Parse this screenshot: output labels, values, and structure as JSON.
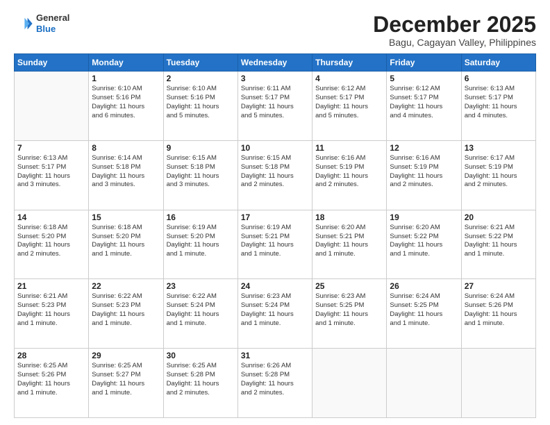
{
  "logo": {
    "general": "General",
    "blue": "Blue"
  },
  "header": {
    "month": "December 2025",
    "location": "Bagu, Cagayan Valley, Philippines"
  },
  "weekdays": [
    "Sunday",
    "Monday",
    "Tuesday",
    "Wednesday",
    "Thursday",
    "Friday",
    "Saturday"
  ],
  "weeks": [
    [
      {
        "day": "",
        "detail": ""
      },
      {
        "day": "1",
        "detail": "Sunrise: 6:10 AM\nSunset: 5:16 PM\nDaylight: 11 hours\nand 6 minutes."
      },
      {
        "day": "2",
        "detail": "Sunrise: 6:10 AM\nSunset: 5:16 PM\nDaylight: 11 hours\nand 5 minutes."
      },
      {
        "day": "3",
        "detail": "Sunrise: 6:11 AM\nSunset: 5:17 PM\nDaylight: 11 hours\nand 5 minutes."
      },
      {
        "day": "4",
        "detail": "Sunrise: 6:12 AM\nSunset: 5:17 PM\nDaylight: 11 hours\nand 5 minutes."
      },
      {
        "day": "5",
        "detail": "Sunrise: 6:12 AM\nSunset: 5:17 PM\nDaylight: 11 hours\nand 4 minutes."
      },
      {
        "day": "6",
        "detail": "Sunrise: 6:13 AM\nSunset: 5:17 PM\nDaylight: 11 hours\nand 4 minutes."
      }
    ],
    [
      {
        "day": "7",
        "detail": "Sunrise: 6:13 AM\nSunset: 5:17 PM\nDaylight: 11 hours\nand 3 minutes."
      },
      {
        "day": "8",
        "detail": "Sunrise: 6:14 AM\nSunset: 5:18 PM\nDaylight: 11 hours\nand 3 minutes."
      },
      {
        "day": "9",
        "detail": "Sunrise: 6:15 AM\nSunset: 5:18 PM\nDaylight: 11 hours\nand 3 minutes."
      },
      {
        "day": "10",
        "detail": "Sunrise: 6:15 AM\nSunset: 5:18 PM\nDaylight: 11 hours\nand 2 minutes."
      },
      {
        "day": "11",
        "detail": "Sunrise: 6:16 AM\nSunset: 5:19 PM\nDaylight: 11 hours\nand 2 minutes."
      },
      {
        "day": "12",
        "detail": "Sunrise: 6:16 AM\nSunset: 5:19 PM\nDaylight: 11 hours\nand 2 minutes."
      },
      {
        "day": "13",
        "detail": "Sunrise: 6:17 AM\nSunset: 5:19 PM\nDaylight: 11 hours\nand 2 minutes."
      }
    ],
    [
      {
        "day": "14",
        "detail": "Sunrise: 6:18 AM\nSunset: 5:20 PM\nDaylight: 11 hours\nand 2 minutes."
      },
      {
        "day": "15",
        "detail": "Sunrise: 6:18 AM\nSunset: 5:20 PM\nDaylight: 11 hours\nand 1 minute."
      },
      {
        "day": "16",
        "detail": "Sunrise: 6:19 AM\nSunset: 5:20 PM\nDaylight: 11 hours\nand 1 minute."
      },
      {
        "day": "17",
        "detail": "Sunrise: 6:19 AM\nSunset: 5:21 PM\nDaylight: 11 hours\nand 1 minute."
      },
      {
        "day": "18",
        "detail": "Sunrise: 6:20 AM\nSunset: 5:21 PM\nDaylight: 11 hours\nand 1 minute."
      },
      {
        "day": "19",
        "detail": "Sunrise: 6:20 AM\nSunset: 5:22 PM\nDaylight: 11 hours\nand 1 minute."
      },
      {
        "day": "20",
        "detail": "Sunrise: 6:21 AM\nSunset: 5:22 PM\nDaylight: 11 hours\nand 1 minute."
      }
    ],
    [
      {
        "day": "21",
        "detail": "Sunrise: 6:21 AM\nSunset: 5:23 PM\nDaylight: 11 hours\nand 1 minute."
      },
      {
        "day": "22",
        "detail": "Sunrise: 6:22 AM\nSunset: 5:23 PM\nDaylight: 11 hours\nand 1 minute."
      },
      {
        "day": "23",
        "detail": "Sunrise: 6:22 AM\nSunset: 5:24 PM\nDaylight: 11 hours\nand 1 minute."
      },
      {
        "day": "24",
        "detail": "Sunrise: 6:23 AM\nSunset: 5:24 PM\nDaylight: 11 hours\nand 1 minute."
      },
      {
        "day": "25",
        "detail": "Sunrise: 6:23 AM\nSunset: 5:25 PM\nDaylight: 11 hours\nand 1 minute."
      },
      {
        "day": "26",
        "detail": "Sunrise: 6:24 AM\nSunset: 5:25 PM\nDaylight: 11 hours\nand 1 minute."
      },
      {
        "day": "27",
        "detail": "Sunrise: 6:24 AM\nSunset: 5:26 PM\nDaylight: 11 hours\nand 1 minute."
      }
    ],
    [
      {
        "day": "28",
        "detail": "Sunrise: 6:25 AM\nSunset: 5:26 PM\nDaylight: 11 hours\nand 1 minute."
      },
      {
        "day": "29",
        "detail": "Sunrise: 6:25 AM\nSunset: 5:27 PM\nDaylight: 11 hours\nand 1 minute."
      },
      {
        "day": "30",
        "detail": "Sunrise: 6:25 AM\nSunset: 5:28 PM\nDaylight: 11 hours\nand 2 minutes."
      },
      {
        "day": "31",
        "detail": "Sunrise: 6:26 AM\nSunset: 5:28 PM\nDaylight: 11 hours\nand 2 minutes."
      },
      {
        "day": "",
        "detail": ""
      },
      {
        "day": "",
        "detail": ""
      },
      {
        "day": "",
        "detail": ""
      }
    ]
  ]
}
